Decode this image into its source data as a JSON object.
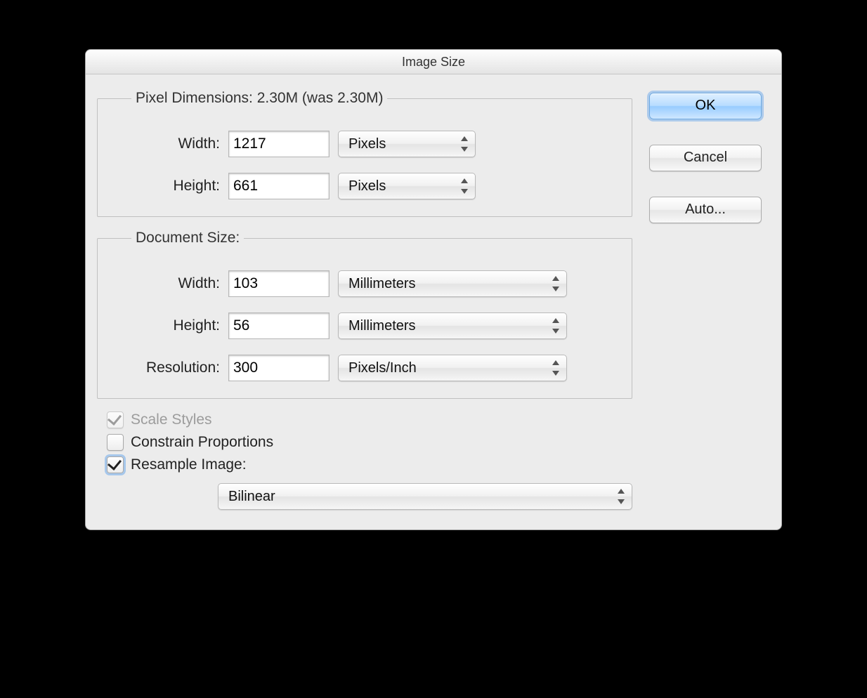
{
  "window": {
    "title": "Image Size"
  },
  "pixel_dimensions": {
    "legend": "Pixel Dimensions:  2.30M (was 2.30M)",
    "width_label": "Width:",
    "width_value": "1217",
    "width_unit": "Pixels",
    "height_label": "Height:",
    "height_value": "661",
    "height_unit": "Pixels"
  },
  "document_size": {
    "legend": "Document Size:",
    "width_label": "Width:",
    "width_value": "103",
    "width_unit": "Millimeters",
    "height_label": "Height:",
    "height_value": "56",
    "height_unit": "Millimeters",
    "resolution_label": "Resolution:",
    "resolution_value": "300",
    "resolution_unit": "Pixels/Inch"
  },
  "options": {
    "scale_styles": {
      "label": "Scale Styles",
      "checked": true,
      "disabled": true
    },
    "constrain_proportions": {
      "label": "Constrain Proportions",
      "checked": false,
      "disabled": false
    },
    "resample_image": {
      "label": "Resample Image:",
      "checked": true,
      "disabled": false
    },
    "resample_method": "Bilinear"
  },
  "buttons": {
    "ok": "OK",
    "cancel": "Cancel",
    "auto": "Auto..."
  }
}
